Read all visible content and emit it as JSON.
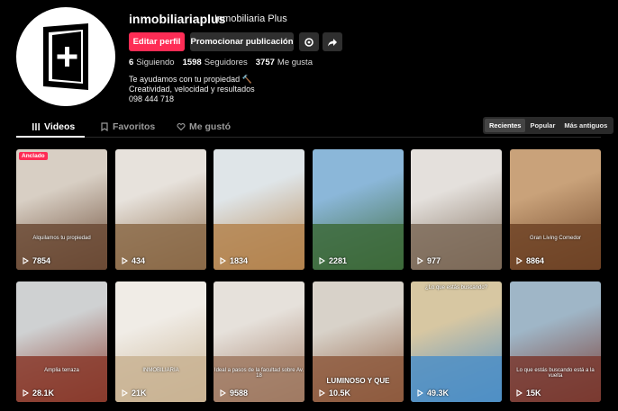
{
  "profile": {
    "username": "inmobiliariaplus",
    "display_name": "Inmobiliaria  Plus",
    "bio": [
      "Te ayudamos con tu propiedad 🔨",
      "Creatividad, velocidad y resultados",
      "098 444 718"
    ]
  },
  "buttons": {
    "edit": "Editar perfil",
    "promote": "Promocionar publicación"
  },
  "stats": [
    {
      "value": "6",
      "label": "Siguiendo"
    },
    {
      "value": "1598",
      "label": "Seguidores"
    },
    {
      "value": "3757",
      "label": "Me gusta"
    }
  ],
  "tabs": [
    {
      "label": "Videos",
      "icon": "grid-icon"
    },
    {
      "label": "Favoritos",
      "icon": "bookmark-icon"
    },
    {
      "label": "Me gustó",
      "icon": "heart-icon"
    }
  ],
  "sort_options": [
    "Recientes",
    "Popular",
    "Más antiguos"
  ],
  "pinned_label": "Anclado",
  "videos": [
    {
      "views": "7854",
      "overlay": "Alquilamos tu propiedad",
      "colors": [
        "#6b4a35",
        "#d8cfc4"
      ]
    },
    {
      "views": "434",
      "overlay": "",
      "colors": [
        "#8b6a48",
        "#e7e2dc"
      ]
    },
    {
      "views": "1834",
      "overlay": "",
      "colors": [
        "#b4844f",
        "#dfe5e8"
      ]
    },
    {
      "views": "2281",
      "overlay": "",
      "colors": [
        "#3d6a3a",
        "#8bb7d9"
      ]
    },
    {
      "views": "977",
      "overlay": "",
      "colors": [
        "#7d6a58",
        "#e4e0dc"
      ]
    },
    {
      "views": "8864",
      "overlay": "Gran Living Comedor",
      "colors": [
        "#6e4326",
        "#c9a27a"
      ]
    },
    {
      "views": "28.1K",
      "overlay": "Amplia terraza",
      "colors": [
        "#8a3b2d",
        "#cfd1d2"
      ]
    },
    {
      "views": "21K",
      "overlay": "INMOBILIARIA",
      "colors": [
        "#c9b393",
        "#f0ece6"
      ]
    },
    {
      "views": "9588",
      "overlay": "Ideal a pasos de la facultad sobre Av. 18",
      "colors": [
        "#a07a63",
        "#e6e1db"
      ]
    },
    {
      "views": "10.5K",
      "overlay": "LUMINOSO Y QUE",
      "colors": [
        "#8e5b3e",
        "#d8d2c9"
      ]
    },
    {
      "views": "49.3K",
      "overlay": "¿Lo que estás buscando?",
      "colors": [
        "#4f8fc5",
        "#d7c7a2"
      ]
    },
    {
      "views": "15K",
      "overlay": "Lo que estás buscando está a la vuelta",
      "colors": [
        "#7a3a30",
        "#9fb6c7"
      ]
    }
  ]
}
